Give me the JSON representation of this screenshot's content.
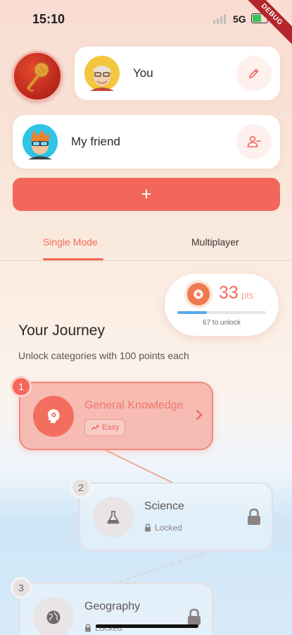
{
  "status_bar": {
    "time": "15:10",
    "network": "5G",
    "debug_banner": "DEBUG"
  },
  "players": {
    "you": {
      "name": "You",
      "action_icon": "pencil-icon"
    },
    "friend": {
      "name": "My friend",
      "action_icon": "remove-user-icon"
    },
    "add_label": "+"
  },
  "tabs": [
    {
      "label": "Single Mode",
      "active": true
    },
    {
      "label": "Multiplayer",
      "active": false
    }
  ],
  "points": {
    "value": "33",
    "unit": "pts",
    "progress_fraction": 0.33,
    "unlock_text": "67 to unlock"
  },
  "journey": {
    "title": "Your Journey",
    "subtitle": "Unlock categories with 100 points each",
    "categories": [
      {
        "number": "1",
        "name": "General Knowledge",
        "status": "Easy",
        "icon": "brain-icon",
        "unlocked": true
      },
      {
        "number": "2",
        "name": "Science",
        "status": "Locked",
        "icon": "flask-icon",
        "unlocked": false
      },
      {
        "number": "3",
        "name": "Geography",
        "status": "Locked",
        "icon": "globe-icon",
        "unlocked": false
      }
    ]
  },
  "colors": {
    "accent": "#f3675a",
    "progress": "#5aa9e6",
    "locked": "#e7e1e2"
  }
}
